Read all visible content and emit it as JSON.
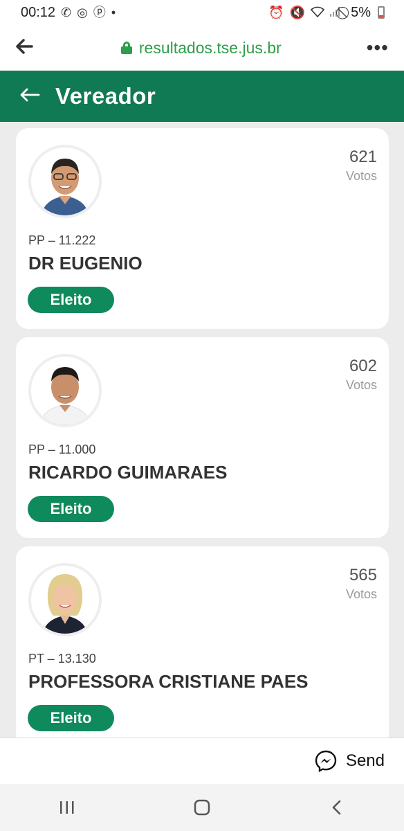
{
  "status_bar": {
    "time": "00:12",
    "battery": "5%",
    "left_icons": [
      "whatsapp-icon",
      "app-icon",
      "pinterest-icon",
      "dot-icon"
    ],
    "right_icons": [
      "alarm-icon",
      "mute-icon",
      "wifi-icon",
      "signal-icon",
      "dnd-icon",
      "battery-icon"
    ]
  },
  "browser": {
    "url": "resultados.tse.jus.br"
  },
  "header": {
    "title": "Vereador"
  },
  "candidates": [
    {
      "party": "PP – 11.222",
      "name": "DR EUGENIO",
      "votes": "621",
      "votes_label": "Votos",
      "status": "Eleito"
    },
    {
      "party": "PP – 11.000",
      "name": "RICARDO GUIMARAES",
      "votes": "602",
      "votes_label": "Votos",
      "status": "Eleito"
    },
    {
      "party": "PT – 13.130",
      "name": "PROFESSORA CRISTIANE PAES",
      "votes": "565",
      "votes_label": "Votos",
      "status": "Eleito"
    }
  ],
  "send_bar": {
    "label": "Send"
  },
  "colors": {
    "header_green": "#107a55",
    "badge_green": "#0f8a5c",
    "url_green": "#2e9e4a"
  }
}
